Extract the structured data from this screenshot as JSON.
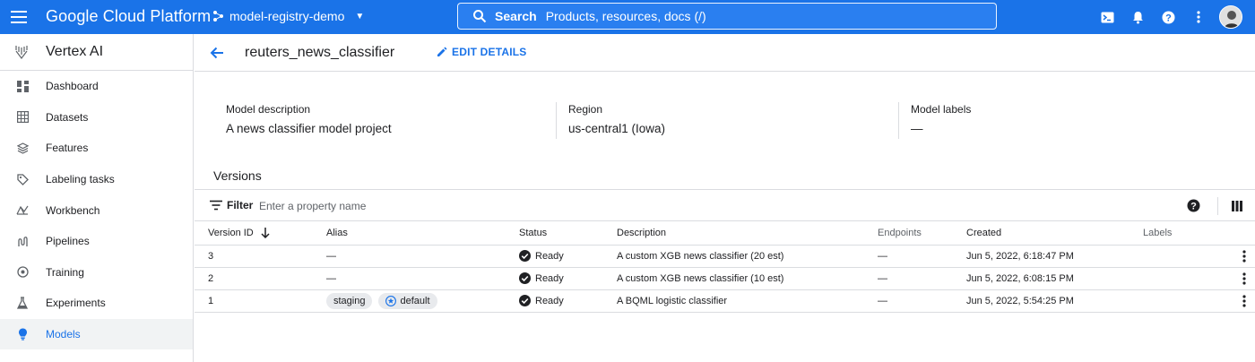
{
  "topbar": {
    "brand": "Google Cloud Platform",
    "project": "model-registry-demo",
    "search_label": "Search",
    "search_placeholder": "Products, resources, docs (/)"
  },
  "sidebar": {
    "title": "Vertex AI",
    "items": [
      {
        "label": "Dashboard",
        "icon": "dashboard-icon"
      },
      {
        "label": "Datasets",
        "icon": "datasets-icon"
      },
      {
        "label": "Features",
        "icon": "features-icon"
      },
      {
        "label": "Labeling tasks",
        "icon": "labeling-icon"
      },
      {
        "label": "Workbench",
        "icon": "workbench-icon"
      },
      {
        "label": "Pipelines",
        "icon": "pipelines-icon"
      },
      {
        "label": "Training",
        "icon": "training-icon"
      },
      {
        "label": "Experiments",
        "icon": "experiments-icon"
      },
      {
        "label": "Models",
        "icon": "models-icon",
        "active": true
      }
    ]
  },
  "page": {
    "title": "reuters_news_classifier",
    "edit_label": "EDIT DETAILS"
  },
  "meta": {
    "description_label": "Model description",
    "description_value": "A news classifier model project",
    "region_label": "Region",
    "region_value": "us-central1 (Iowa)",
    "labels_label": "Model labels",
    "labels_value": "—"
  },
  "versions": {
    "title": "Versions",
    "filter_label": "Filter",
    "filter_placeholder": "Enter a property name",
    "columns": [
      "Version ID",
      "Alias",
      "Status",
      "Description",
      "Endpoints",
      "Created",
      "Labels"
    ],
    "rows": [
      {
        "id": "3",
        "alias": "—",
        "status": "Ready",
        "description": "A custom XGB news classifier (20 est)",
        "endpoints": "—",
        "created": "Jun 5, 2022, 6:18:47 PM"
      },
      {
        "id": "2",
        "alias": "—",
        "status": "Ready",
        "description": "A custom XGB news classifier (10 est)",
        "endpoints": "—",
        "created": "Jun 5, 2022, 6:08:15 PM"
      },
      {
        "id": "1",
        "alias_chips": [
          "staging",
          "default"
        ],
        "status": "Ready",
        "description": "A BQML logistic classifier",
        "endpoints": "—",
        "created": "Jun 5, 2022, 5:54:25 PM"
      }
    ]
  },
  "colors": {
    "brand_blue": "#1a73e8",
    "active_bg": "#f1f3f4",
    "border": "#dadce0"
  }
}
